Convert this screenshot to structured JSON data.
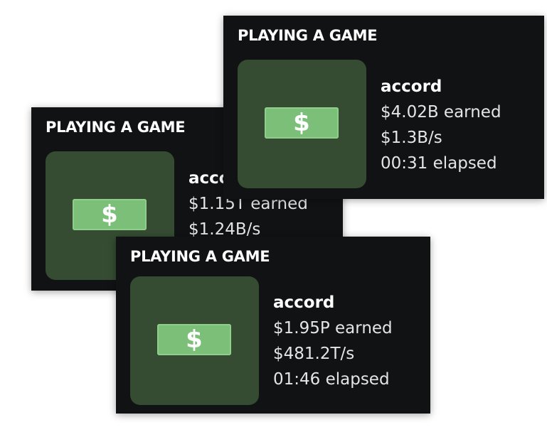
{
  "cards": [
    {
      "header": "PLAYING A GAME",
      "game_name": "accord",
      "earned": "$1.15T earned",
      "rate": "$1.24B/s",
      "elapsed": "",
      "icon": "dollar-bill-icon",
      "bill_symbol": "$"
    },
    {
      "header": "PLAYING A GAME",
      "game_name": "accord",
      "earned": "$4.02B earned",
      "rate": "$1.3B/s",
      "elapsed": "00:31 elapsed",
      "icon": "dollar-bill-icon",
      "bill_symbol": "$"
    },
    {
      "header": "PLAYING A GAME",
      "game_name": "accord",
      "earned": "$1.95P earned",
      "rate": "$481.2T/s",
      "elapsed": "01:46 elapsed",
      "icon": "dollar-bill-icon",
      "bill_symbol": "$"
    }
  ],
  "colors": {
    "card_background": "#111214",
    "art_background": "#354c32",
    "bill_green": "#7bbf78",
    "text_primary": "#ffffff",
    "text_secondary": "#e3e5e8"
  }
}
